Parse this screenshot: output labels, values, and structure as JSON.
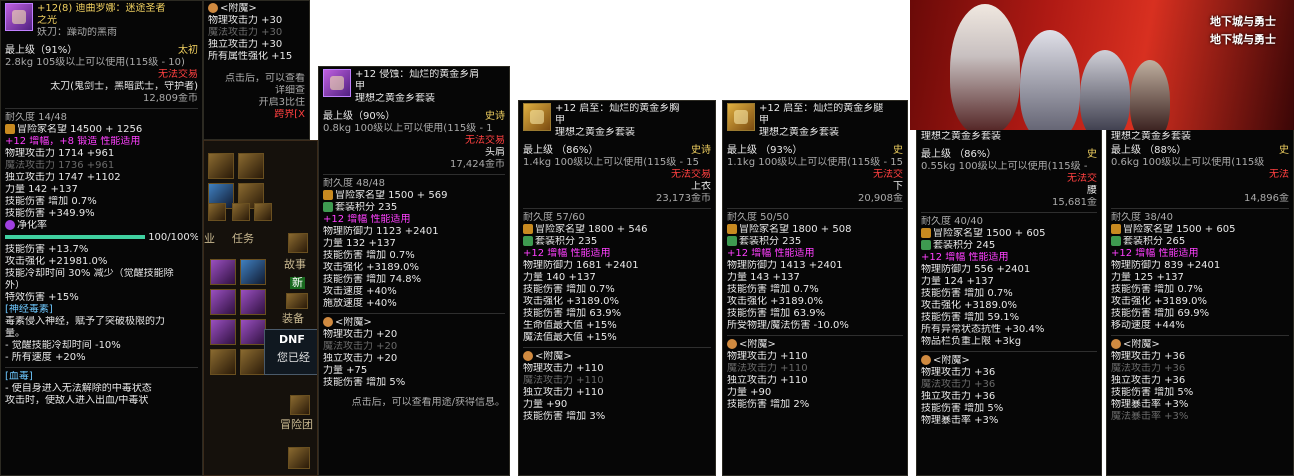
{
  "banner": {
    "logo_line1": "地下城与勇士",
    "logo_line2": "地下城与勇士"
  },
  "p1": {
    "title_line1": "+12(8) 迪曲罗娜：迷途圣者",
    "title_line2": "之光",
    "subtitle": "妖刀：躁动的黑雨",
    "rarity": "最上级（91%）",
    "rarity_tag": "太初",
    "weight_req": "2.8kg    105级以上可以使用(115级 - 10)",
    "trade": "无法交易",
    "classes": "太刀(鬼剑士，黑暗武士，守护者)",
    "price": "12,809金币",
    "durability": "耐久度 14/48",
    "adv_fame": "冒险家名望 14500 + 1256",
    "amplify": "+12 增幅，+8 锻造 性能适用",
    "phys_atk": "物理攻击力 1714 +961",
    "mag_atk": "魔法攻击力 1736 +961",
    "indep_atk": "独立攻击力 1747 +1102",
    "str": "力量 142 +137",
    "skill_dmg1": "技能伤害 增加 0.7%",
    "skill_dmg2": "技能伤害 +349.9%",
    "purify_label": "净化率",
    "purify_value": "100/100%",
    "purify_ratio": 1.0,
    "skill_dmg3": "技能伤害 +13.7%",
    "atk_up": "攻击强化 +21981.0%",
    "cooldown1": "技能冷却时间 30% 减少（觉醒技能除",
    "cooldown2": "外）",
    "special": "特效伤害 +15%",
    "neuro_title": "[神经毒素]",
    "neuro_desc1": "毒素侵入神经，赋予了突破极限的力",
    "neuro_desc2": "量。",
    "neuro_b1": "- 觉醒技能冷却时间 -10%",
    "neuro_b2": "- 所有速度 +20%",
    "blood_title": "[血毒]",
    "blood_b1": "- 使自身进入无法解除的中毒状态",
    "blood_b2": "  攻击时，使敌人进入出血/中毒状"
  },
  "p2": {
    "enchant_title": "<附魔>",
    "phys": "物理攻击力 +30",
    "mag": "魔法攻击力 +30",
    "indep": "独立攻击力 +30",
    "all_attr": "所有属性强化 +15",
    "hint1": "点击后，可以查看",
    "hint2": "详细查",
    "hint3": "开启3比住",
    "hint4": "跨界[X"
  },
  "mid_ui": {
    "tab_job": "业",
    "tab_task": "任务",
    "story": "故事",
    "new_badge": "新",
    "equip": "装备",
    "dnf": "DNF",
    "notice": "您已经",
    "adventure": "冒险团"
  },
  "p3": {
    "title_line1": "+12  侵蚀：灿烂的黄金乡肩",
    "title_line2": "甲",
    "set_name": "理想之黄金乡套装",
    "rarity": "最上级（90%）",
    "rarity_tag": "史诗",
    "weight_req": "0.8kg    100级以上可以使用(115级 - 1",
    "trade": "无法交易",
    "slot": "头肩",
    "price": "17,424金币",
    "durability": "耐久度 48/48",
    "adv_fame": "冒险家名望 1500 + 569",
    "set_points": "套装积分 235",
    "amplify": "+12 增幅 性能适用",
    "phys_def": "物理防御力 1123 +2401",
    "str": "力量 132 +137",
    "skill_dmg": "技能伤害 增加 0.7%",
    "atk_up": "攻击强化 +3189.0%",
    "skill_dmg2": "技能伤害 增加 74.8%",
    "atk_speed": "攻击速度 +40%",
    "cast_speed": "施放速度 +40%",
    "enchant_title": "<附魔>",
    "e_phys": "物理攻击力 +20",
    "e_mag": "魔法攻击力 +20",
    "e_indep": "独立攻击力 +20",
    "e_str": "力量 +75",
    "e_skill": "技能伤害 增加 5%",
    "hint": "点击后，可以查看用途/获得信息。"
  },
  "p4": {
    "title_line1": "+12  启至：灿烂的黄金乡胸",
    "title_line2": "甲",
    "set_name": "理想之黄金乡套装",
    "rarity": "最上级  （86%）",
    "rarity_tag": "史诗",
    "weight_req": "1.4kg    100级以上可以使用(115级 - 15",
    "trade": "无法交易",
    "slot": "上衣",
    "price": "23,173金币",
    "durability": "耐久度 57/60",
    "adv_fame": "冒险家名望 1800 + 546",
    "set_points": "套装积分 235",
    "amplify": "+12 增幅 性能适用",
    "phys_def": "物理防御力 1681 +2401",
    "str": "力量 140 +137",
    "skill_dmg": "技能伤害 增加 0.7%",
    "atk_up": "攻击强化 +3189.0%",
    "skill_dmg2": "技能伤害 增加 63.9%",
    "hp_max": "生命值最大值 +15%",
    "mp_max": "魔法值最大值 +15%",
    "enchant_title": "<附魔>",
    "e_phys": "物理攻击力 +110",
    "e_mag": "魔法攻击力 +110",
    "e_indep": "独立攻击力 +110",
    "e_str": "力量 +90",
    "e_skill": "技能伤害 增加 3%"
  },
  "p5": {
    "title_line1": "+12  启至：灿烂的黄金乡腿",
    "title_line2": "甲",
    "set_name": "理想之黄金乡套装",
    "rarity": "最上级  （93%）",
    "rarity_tag": "史",
    "weight_req": "1.1kg    100级以上可以使用(115级 - 15",
    "trade": "无法交",
    "slot": "下",
    "price": "20,908金",
    "durability": "耐久度 50/50",
    "adv_fame": "冒险家名望 1800 + 508",
    "set_points": "套装积分 235",
    "amplify": "+12 增幅 性能适用",
    "phys_def": "物理防御力 1413 +2401",
    "str": "力量 143 +137",
    "skill_dmg": "技能伤害 增加 0.7%",
    "atk_up": "攻击强化 +3189.0%",
    "skill_dmg2": "技能伤害 增加 63.9%",
    "ignore_def": "所受物理/魔法伤害 -10.0%",
    "enchant_title": "<附魔>",
    "e_phys": "物理攻击力 +110",
    "e_mag": "魔法攻击力 +110",
    "e_indep": "独立攻击力 +110",
    "e_str": "力量 +90",
    "e_skill": "技能伤害 增加 2%"
  },
  "p6": {
    "set_name": "理想之黄金乡套装",
    "rarity": "最上级  （86%）",
    "rarity_tag": "史",
    "weight_req": "0.55kg  100级以上可以使用(115级 -",
    "trade": "无法交",
    "slot": "腰",
    "price": "15,681金",
    "durability": "耐久度 40/40",
    "adv_fame": "冒险家名望 1500 + 605",
    "set_points": "套装积分 245",
    "amplify": "+12 增幅 性能适用",
    "phys_def": "物理防御力 556 +2401",
    "str": "力量 124 +137",
    "skill_dmg": "技能伤害 增加 0.7%",
    "atk_up": "攻击强化 +3189.0%",
    "skill_dmg2": "技能伤害 增加 59.1%",
    "status_res": "所有异常状态抗性 +30.4%",
    "weight_limit": "物品栏负重上限 +3kg",
    "enchant_title": "<附魔>",
    "e_phys": "物理攻击力 +36",
    "e_mag": "魔法攻击力 +36",
    "e_indep": "独立攻击力 +36",
    "e_skill": "技能伤害 增加 5%",
    "e_crit": "物理暴击率 +3%"
  },
  "p7": {
    "set_name": "理想之黄金乡套装",
    "rarity": "最上级  （88%）",
    "rarity_tag": "史",
    "weight_req": "0.6kg    100级以上可以使用(115级",
    "trade": "无法",
    "price": "14,896金",
    "durability": "耐久度 38/40",
    "adv_fame": "冒险家名望 1500 + 605",
    "set_points": "套装积分 265",
    "amplify": "+12 增幅 性能适用",
    "phys_def": "物理防御力 839 +2401",
    "str": "力量 125 +137",
    "skill_dmg": "技能伤害 增加 0.7%",
    "atk_up": "攻击强化 +3189.0%",
    "skill_dmg2": "技能伤害 增加 69.9%",
    "move_speed": "移动速度 +44%",
    "enchant_title": "<附魔>",
    "e_phys": "物理攻击力 +36",
    "e_mag": "魔法攻击力 +36",
    "e_indep": "独立攻击力 +36",
    "e_skill": "技能伤害 增加 5%",
    "e_crit1": "物理暴击率 +3%",
    "e_crit2": "魔法暴击率 +3%"
  }
}
